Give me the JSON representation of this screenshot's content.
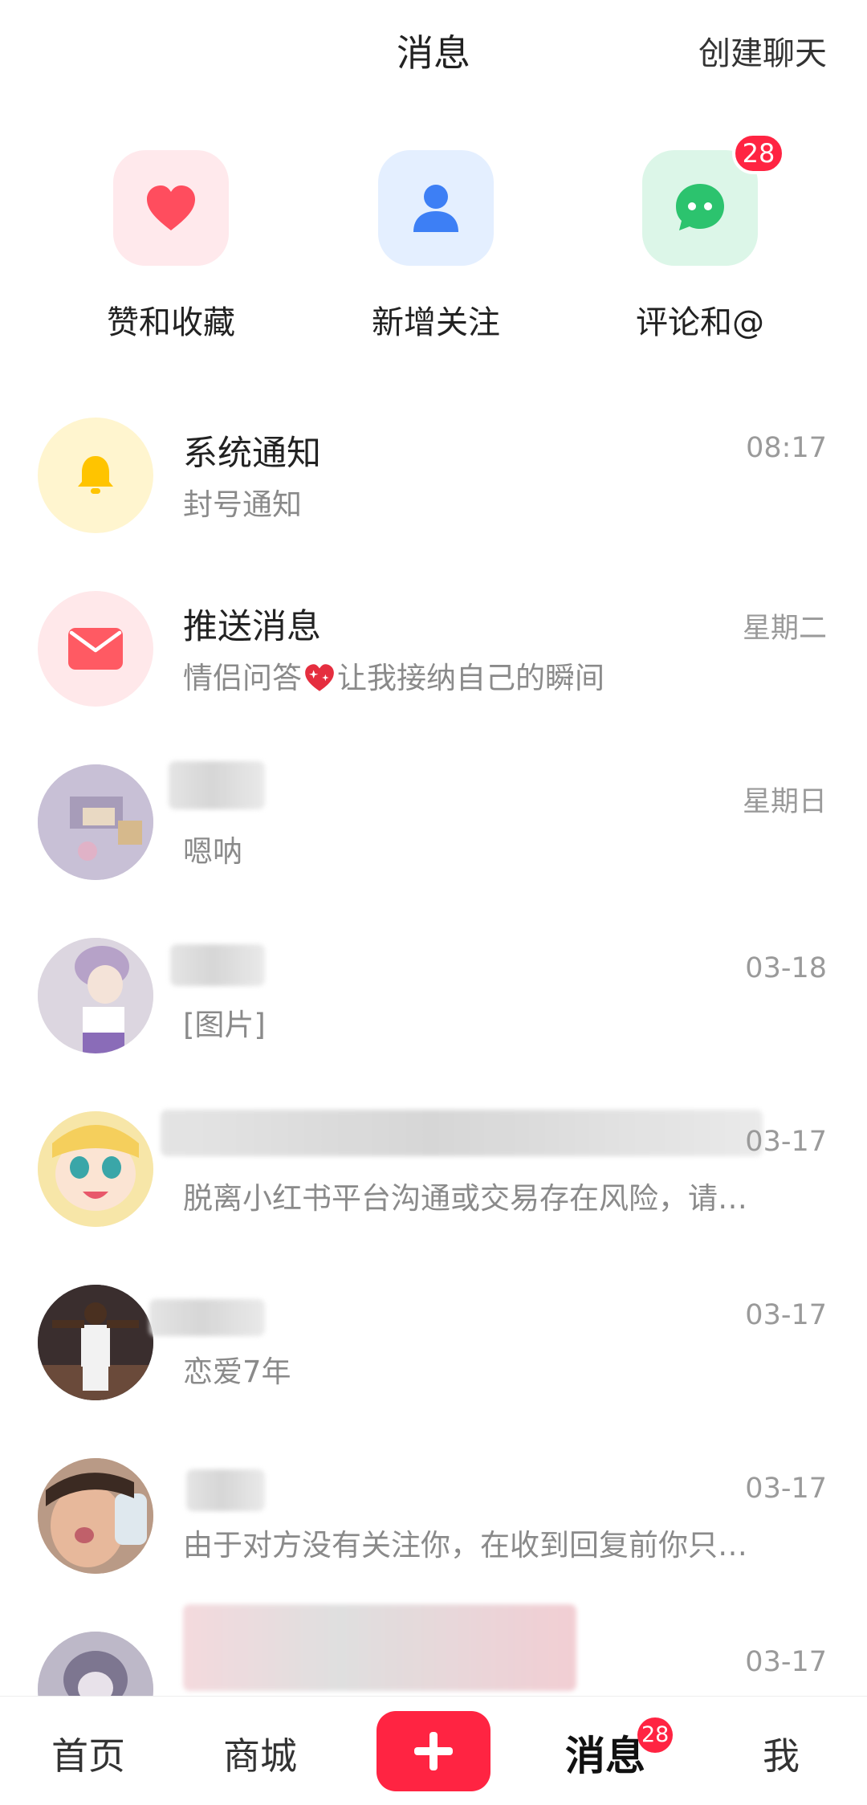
{
  "header": {
    "title": "消息",
    "create_chat": "创建聊天"
  },
  "shortcuts": [
    {
      "label": "赞和收藏",
      "icon": "heart-icon",
      "badge": ""
    },
    {
      "label": "新增关注",
      "icon": "person-icon",
      "badge": ""
    },
    {
      "label": "评论和@",
      "icon": "chat-bubble-icon",
      "badge": "28"
    }
  ],
  "conversations": [
    {
      "name": "系统通知",
      "preview": "封号通知",
      "time": "08:17",
      "avatar": "bell-icon"
    },
    {
      "name": "推送消息",
      "preview_before": "情侣问答",
      "preview_after": "让我接纳自己的瞬间",
      "preview_emoji": "sparkle-heart-icon",
      "time": "星期二",
      "avatar": "envelope-icon"
    },
    {
      "name": "",
      "preview": "嗯呐",
      "time": "星期日",
      "avatar": "user-avatar"
    },
    {
      "name": "",
      "preview": "[图片]",
      "time": "03-18",
      "avatar": "user-avatar"
    },
    {
      "name": "",
      "preview": "脱离小红书平台沟通或交易存在风险，请…",
      "time": "03-17",
      "avatar": "user-avatar"
    },
    {
      "name": "",
      "preview": "恋爱7年",
      "time": "03-17",
      "avatar": "user-avatar"
    },
    {
      "name": "",
      "preview": "由于对方没有关注你，在收到回复前你只…",
      "time": "03-17",
      "avatar": "user-avatar"
    },
    {
      "name": "",
      "preview": "",
      "time": "03-17",
      "avatar": "user-avatar"
    }
  ],
  "bottom_nav": {
    "home": "首页",
    "mall": "商城",
    "add": "plus-icon",
    "messages": "消息",
    "messages_badge": "28",
    "me": "我"
  },
  "colors": {
    "accent": "#ff2442",
    "heart": "#ff4d5e",
    "person": "#3d7ff5",
    "chat": "#2cc36e",
    "bell": "#ffc400",
    "envelope": "#ff5a63"
  }
}
